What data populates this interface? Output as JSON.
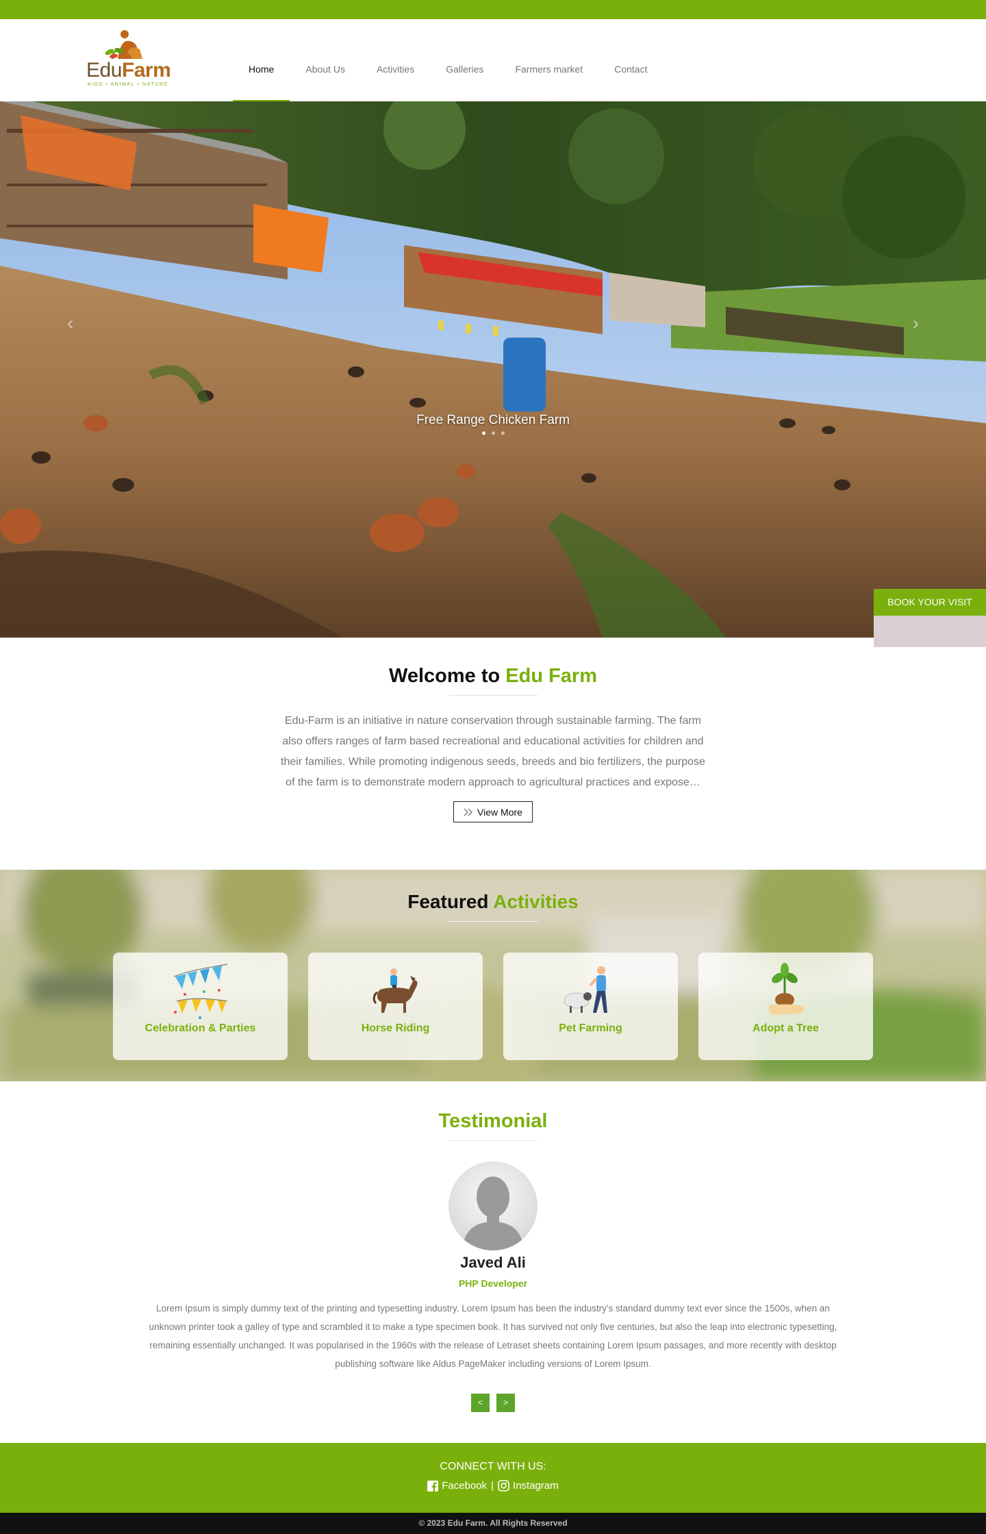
{
  "colors": {
    "brand_green": "#7ab00c",
    "button_green": "#5ea52b",
    "book_pad": "#dacfd2"
  },
  "logo": {
    "word_1": "Edu",
    "word_2": "Farm",
    "tagline": "KIDS • ANIMAL • NATURE"
  },
  "nav": {
    "items": [
      {
        "label": "Home",
        "active": true
      },
      {
        "label": "About Us"
      },
      {
        "label": "Activities"
      },
      {
        "label": "Galleries"
      },
      {
        "label": "Farmers market"
      },
      {
        "label": "Contact"
      }
    ]
  },
  "hero": {
    "caption": "Free Range Chicken Farm",
    "prev_icon": "chevron-left-icon",
    "next_icon": "chevron-right-icon",
    "active_slide": 1,
    "slide_count": 3
  },
  "book": {
    "label": "BOOK YOUR VISIT"
  },
  "welcome": {
    "title_1": "Welcome to",
    "title_2": "Edu Farm",
    "text": "Edu-Farm is an initiative in nature conservation through sustainable farming. The farm also offers ranges of farm based recreational and educational activities for children and their families. While promoting indigenous seeds, breeds and bio fertilizers, the purpose of the farm is to demonstrate modern approach to agricultural practices and expose…",
    "button": "View More"
  },
  "featured": {
    "title_1": "Featured",
    "title_2": "Activities",
    "cards": [
      {
        "label": "Celebration & Parties",
        "icon": "bunting-flags-icon"
      },
      {
        "label": "Horse Riding",
        "icon": "horse-rider-icon"
      },
      {
        "label": "Pet Farming",
        "icon": "farmer-sheep-icon"
      },
      {
        "label": "Adopt a Tree",
        "icon": "sapling-hand-icon"
      }
    ]
  },
  "testimonial": {
    "title": "Testimonial",
    "name": "Javed Ali",
    "role": "PHP Developer",
    "text": "Lorem Ipsum is simply dummy text of the printing and typesetting industry. Lorem Ipsum has been the industry's standard dummy text ever since the 1500s, when an unknown printer took a galley of type and scrambled it to make a type specimen book. It has survived not only five centuries, but also the leap into electronic typesetting, remaining essentially unchanged. It was popularised in the 1960s with the release of Letraset sheets containing Lorem Ipsum passages, and more recently with desktop publishing software like Aldus PageMaker including versions of Lorem Ipsum.",
    "prev": "<",
    "next": ">"
  },
  "footer": {
    "connect": "CONNECT WITH US:",
    "facebook": "Facebook",
    "separator": "|",
    "instagram": "Instagram",
    "copyright": "© 2023 Edu Farm. All Rights Reserved"
  }
}
